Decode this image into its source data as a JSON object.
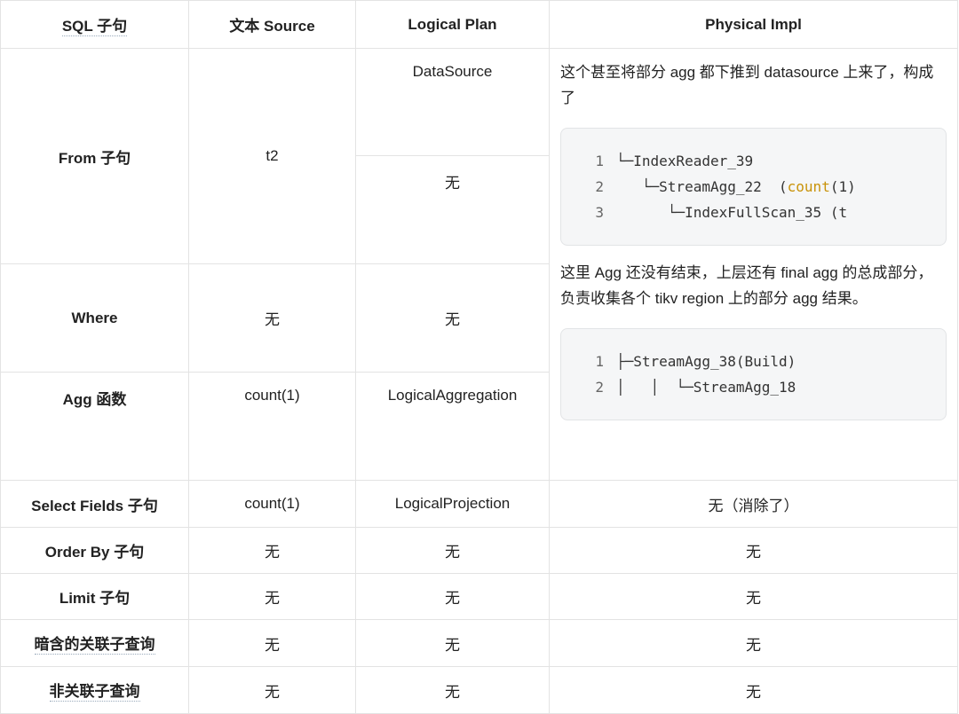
{
  "headers": [
    "SQL 子句",
    "文本 Source",
    "Logical Plan",
    "Physical Impl"
  ],
  "rows": [
    {
      "clause": "From 子句",
      "source": "t2",
      "logical": [
        "DataSource",
        "无"
      ]
    },
    {
      "clause": "Where",
      "source": "无",
      "logical": "无"
    },
    {
      "clause": "Agg 函数",
      "source": "count(1)",
      "logical": "LogicalAggregation"
    },
    {
      "clause": "Select Fields 子句",
      "source": "count(1)",
      "logical": "LogicalProjection",
      "physical": "无（消除了）"
    },
    {
      "clause": "Order By 子句",
      "source": "无",
      "logical": "无",
      "physical": "无"
    },
    {
      "clause": "Limit 子句",
      "source": "无",
      "logical": "无",
      "physical": "无"
    },
    {
      "clause": "暗含的关联子查询",
      "source": "无",
      "logical": "无",
      "physical": "无"
    },
    {
      "clause": "非关联子查询",
      "source": "无",
      "logical": "无",
      "physical": "无"
    }
  ],
  "physical_block": {
    "para1": "这个甚至将部分 agg 都下推到 datasource 上来了，构成了",
    "code1": [
      {
        "n": "1",
        "pre": "└─IndexReader_39",
        "kw": "",
        "post": ""
      },
      {
        "n": "2",
        "pre": "   └─StreamAgg_22  (",
        "kw": "count",
        "post": "(1)"
      },
      {
        "n": "3",
        "pre": "      └─IndexFullScan_35 (t",
        "kw": "",
        "post": ""
      }
    ],
    "para2": "这里 Agg 还没有结束，上层还有 final agg 的总成部分，负责收集各个 tikv region 上的部分 agg 结果。",
    "code2": [
      {
        "n": "1",
        "pre": "├─StreamAgg_38(Build)",
        "kw": "",
        "post": ""
      },
      {
        "n": "2",
        "pre": "│   │  └─StreamAgg_18",
        "kw": "",
        "post": ""
      }
    ],
    "keyword_color": "#c9930a"
  }
}
